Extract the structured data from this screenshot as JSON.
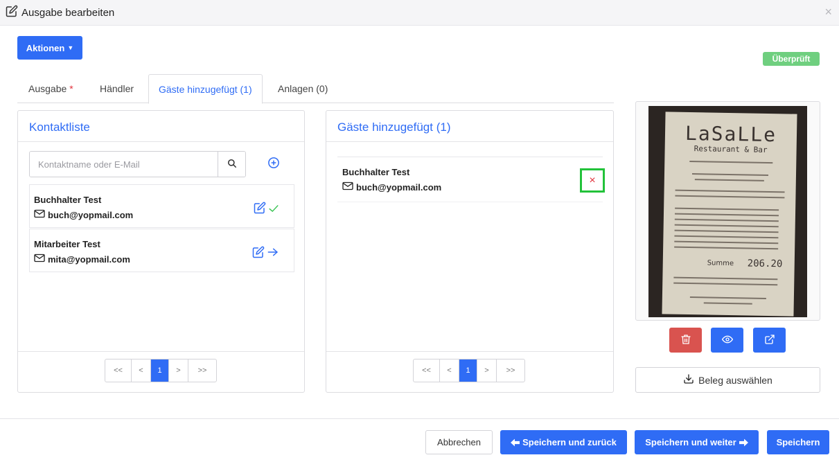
{
  "header": {
    "title": "Ausgabe bearbeiten",
    "close_label": "×"
  },
  "toolbar": {
    "actions_label": "Aktionen",
    "status_badge": "Überprüft"
  },
  "tabs": [
    {
      "label": "Ausgabe",
      "required_mark": "*"
    },
    {
      "label": "Händler"
    },
    {
      "label": "Gäste hinzugefügt (1)",
      "active": true
    },
    {
      "label": "Anlagen (0)"
    }
  ],
  "contacts": {
    "title": "Kontaktliste",
    "search_placeholder": "Kontaktname oder E-Mail",
    "items": [
      {
        "name": "Buchhalter Test",
        "email": "buch@yopmail.com",
        "status": "added"
      },
      {
        "name": "Mitarbeiter Test",
        "email": "mita@yopmail.com",
        "status": "available"
      }
    ],
    "pager": {
      "first": "<<",
      "prev": "<",
      "current": "1",
      "next": ">",
      "last": ">>"
    }
  },
  "guests": {
    "title": "Gäste hinzugefügt (1)",
    "items": [
      {
        "name": "Buchhalter Test",
        "email": "buch@yopmail.com"
      }
    ],
    "remove_label": "×",
    "pager": {
      "first": "<<",
      "prev": "<",
      "current": "1",
      "next": ">",
      "last": ">>"
    }
  },
  "receipt": {
    "brand": "LaSaLLe",
    "subtitle": "Restaurant & Bar",
    "total_label": "Summe",
    "total_value": "206.20",
    "select_label": "Beleg auswählen"
  },
  "footer": {
    "cancel_label": "Abbrechen",
    "save_back_label": "Speichern und zurück",
    "save_next_label": "Speichern und weiter",
    "save_label": "Speichern"
  },
  "colors": {
    "primary": "#2f6cf5",
    "danger": "#d9534f",
    "success": "#6fcf7f",
    "highlight": "#22c23a"
  }
}
